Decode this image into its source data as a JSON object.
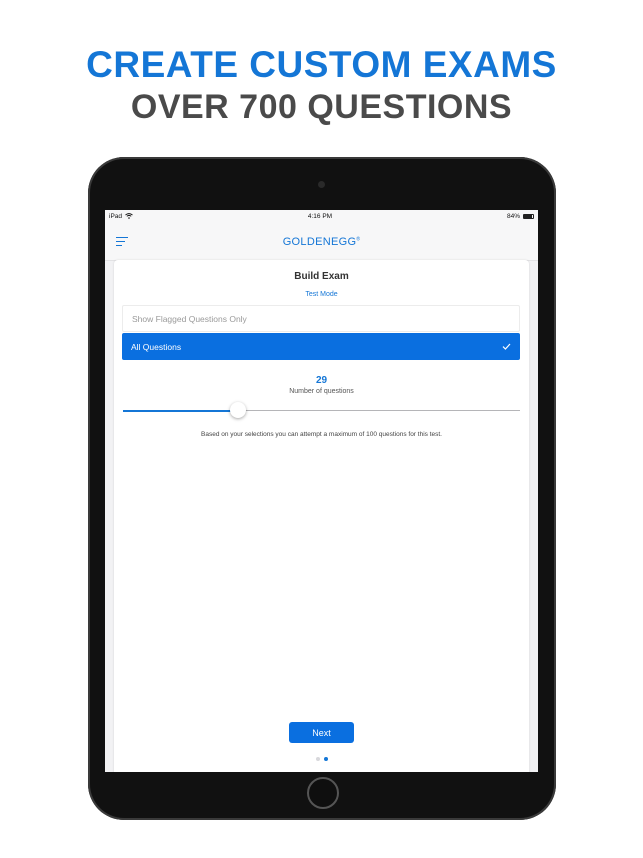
{
  "headline": {
    "line1": "CREATE CUSTOM EXAMS",
    "line2": "OVER 700 QUESTIONS"
  },
  "status_bar": {
    "device": "iPad",
    "time": "4:16 PM",
    "battery": "84%",
    "battery_level": 0.84
  },
  "nav": {
    "brand": "GOLDENEGG",
    "brand_mark": "®"
  },
  "build_exam": {
    "title": "Build Exam",
    "mode": "Test Mode",
    "options": [
      {
        "label": "Show Flagged Questions Only",
        "selected": false
      },
      {
        "label": "All Questions",
        "selected": true
      }
    ],
    "question_count": "29",
    "question_count_label": "Number of questions",
    "slider_fraction": 0.29,
    "info": "Based on your selections you can attempt a maximum of 100 questions for this test.",
    "next_label": "Next"
  },
  "pagination": {
    "total": 2,
    "current": 2
  },
  "colors": {
    "accent": "#1476d6",
    "selected_bg": "#0a6fe0",
    "subheadline": "#4a4a4a"
  },
  "icons": {
    "menu": "hamburger-menu-icon",
    "wifi": "wifi-icon",
    "battery": "battery-icon",
    "check": "checkmark-icon"
  }
}
